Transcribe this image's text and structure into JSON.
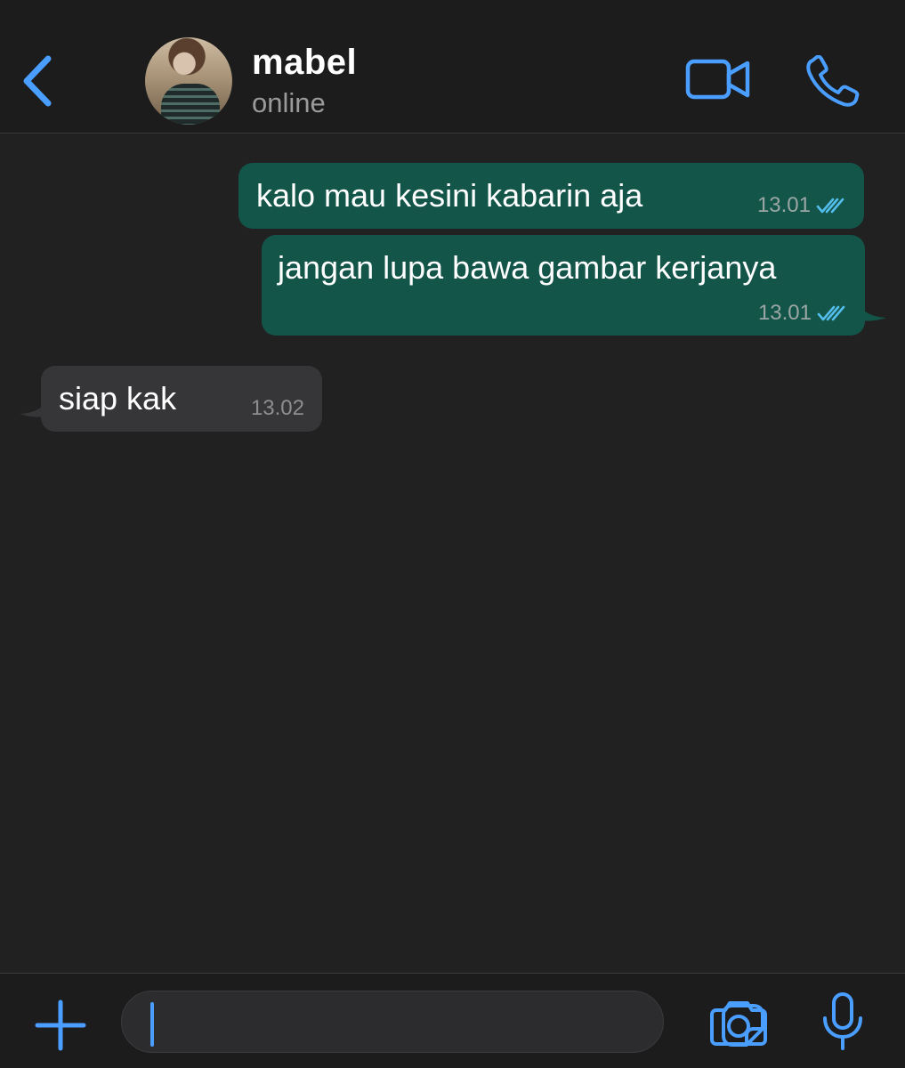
{
  "header": {
    "contact_name": "mabel",
    "contact_status": "online"
  },
  "messages": [
    {
      "direction": "outgoing",
      "text": "kalo mau kesini kabarin aja",
      "time": "13.01",
      "status": "read"
    },
    {
      "direction": "outgoing",
      "text": "jangan lupa bawa gambar kerjanya",
      "time": "13.01",
      "status": "read"
    },
    {
      "direction": "incoming",
      "text": "siap kak",
      "time": "13.02"
    }
  ],
  "input": {
    "value": "",
    "placeholder": ""
  },
  "icons": {
    "back": "chevron-left-icon",
    "video_call": "video-camera-icon",
    "voice_call": "phone-icon",
    "attach": "plus-icon",
    "sticker": "sticker-icon",
    "camera": "camera-icon",
    "microphone": "microphone-icon",
    "read_receipt": "double-check-icon"
  },
  "colors": {
    "accent": "#4a9eff",
    "outgoing_bubble": "#14554a",
    "incoming_bubble": "#363638",
    "background": "#212121",
    "read_tick": "#53bdeb"
  }
}
